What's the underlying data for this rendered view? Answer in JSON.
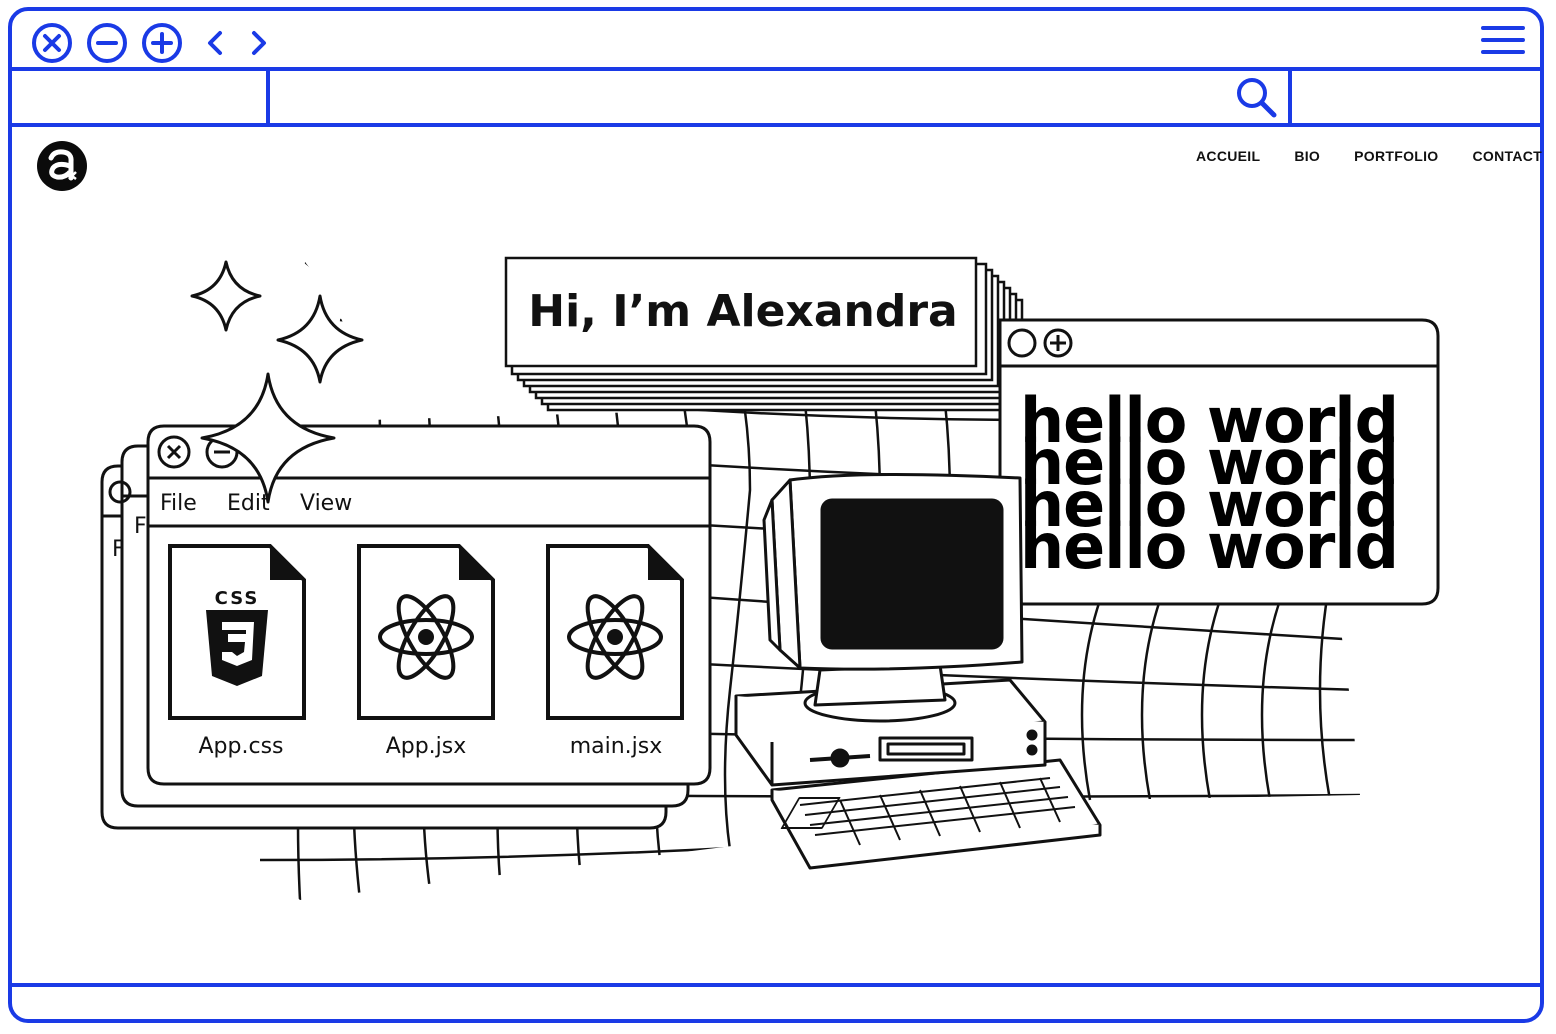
{
  "browser": {
    "accent_color": "#1a3ae6",
    "controls": [
      "close-icon",
      "minimize-icon",
      "maximize-icon",
      "back-icon",
      "forward-icon"
    ],
    "menu_icon": "hamburger-menu-icon",
    "search_icon": "search-icon"
  },
  "site": {
    "nav": [
      "ACCUEIL",
      "BIO",
      "PORTFOLIO",
      "CONTACT"
    ]
  },
  "hero": {
    "greeting": "Hi, I’m Alexandra",
    "hello_lines": [
      "hello world",
      "hello world",
      "hello world",
      "hello world"
    ]
  },
  "file_window": {
    "menu": [
      "File",
      "Edit",
      "View"
    ],
    "files": [
      {
        "name": "App.css",
        "icon": "css3-file-icon"
      },
      {
        "name": "App.jsx",
        "icon": "react-file-icon"
      },
      {
        "name": "main.jsx",
        "icon": "react-file-icon"
      }
    ]
  }
}
